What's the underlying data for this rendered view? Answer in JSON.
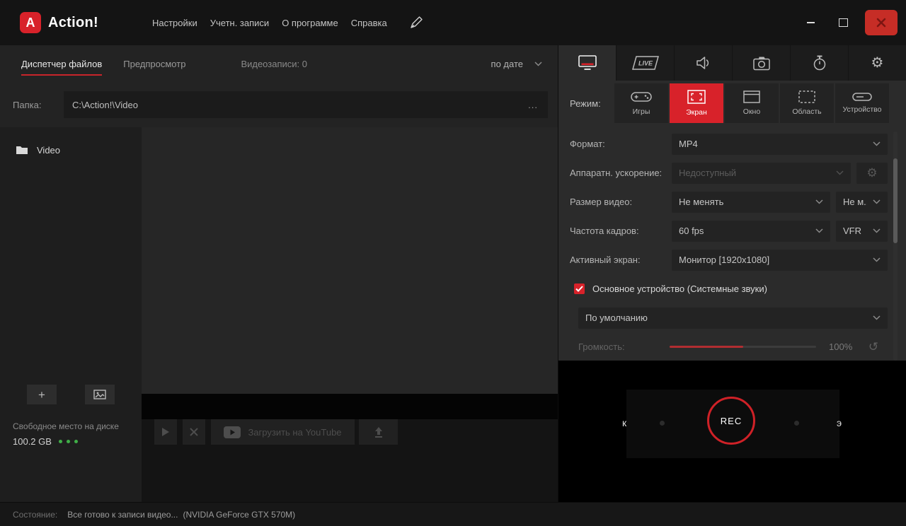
{
  "window": {
    "logo_letter": "A",
    "title": "Action!",
    "menu": [
      "Настройки",
      "Учетн. записи",
      "О программе",
      "Справка"
    ]
  },
  "file_manager": {
    "tab_file_manager": "Диспетчер файлов",
    "tab_preview": "Предпросмотр",
    "recordings_label": "Видеозаписи: 0",
    "sort_label": "по дате",
    "folder_label": "Папка:",
    "folder_path": "C:\\Action!\\Video",
    "browse_label": "...",
    "video_folder_label": "Video",
    "free_space_label": "Свободное место на диске",
    "free_space_value": "100.2 GB",
    "youtube_button_label": "Загрузить на YouTube"
  },
  "side_tabs": {
    "live_label": "LIVE"
  },
  "recording": {
    "mode_label": "Режим:",
    "modes": [
      {
        "label": "Игры"
      },
      {
        "label": "Экран"
      },
      {
        "label": "Окно"
      },
      {
        "label": "Область"
      },
      {
        "label": "Устройство"
      }
    ],
    "format_label": "Формат:",
    "format_value": "MP4",
    "hw_accel_label": "Аппаратн. ускорение:",
    "hw_accel_value": "Недоступный",
    "video_size_label": "Размер видео:",
    "video_size_value": "Не менять",
    "video_size_value2": "Не м...",
    "framerate_label": "Частота кадров:",
    "framerate_value": "60 fps",
    "framerate_mode": "VFR",
    "active_screen_label": "Активный экран:",
    "active_screen_value": "Монитор [1920x1080]"
  },
  "audio": {
    "primary_device_label": "Основное устройство (Системные звуки)",
    "device_value": "По умолчанию",
    "volume_label": "Громкость:",
    "volume_value": "100%"
  },
  "hud": {
    "left_fragment": "к",
    "rec_label": "REC",
    "right_fragment": "э"
  },
  "status_bar": {
    "label": "Состояние:",
    "status": "Все готово к записи видео...",
    "gpu": "(NVIDIA GeForce GTX 570M)"
  },
  "icons": {
    "gear": "⚙",
    "reset": "↺",
    "plus": "+"
  }
}
